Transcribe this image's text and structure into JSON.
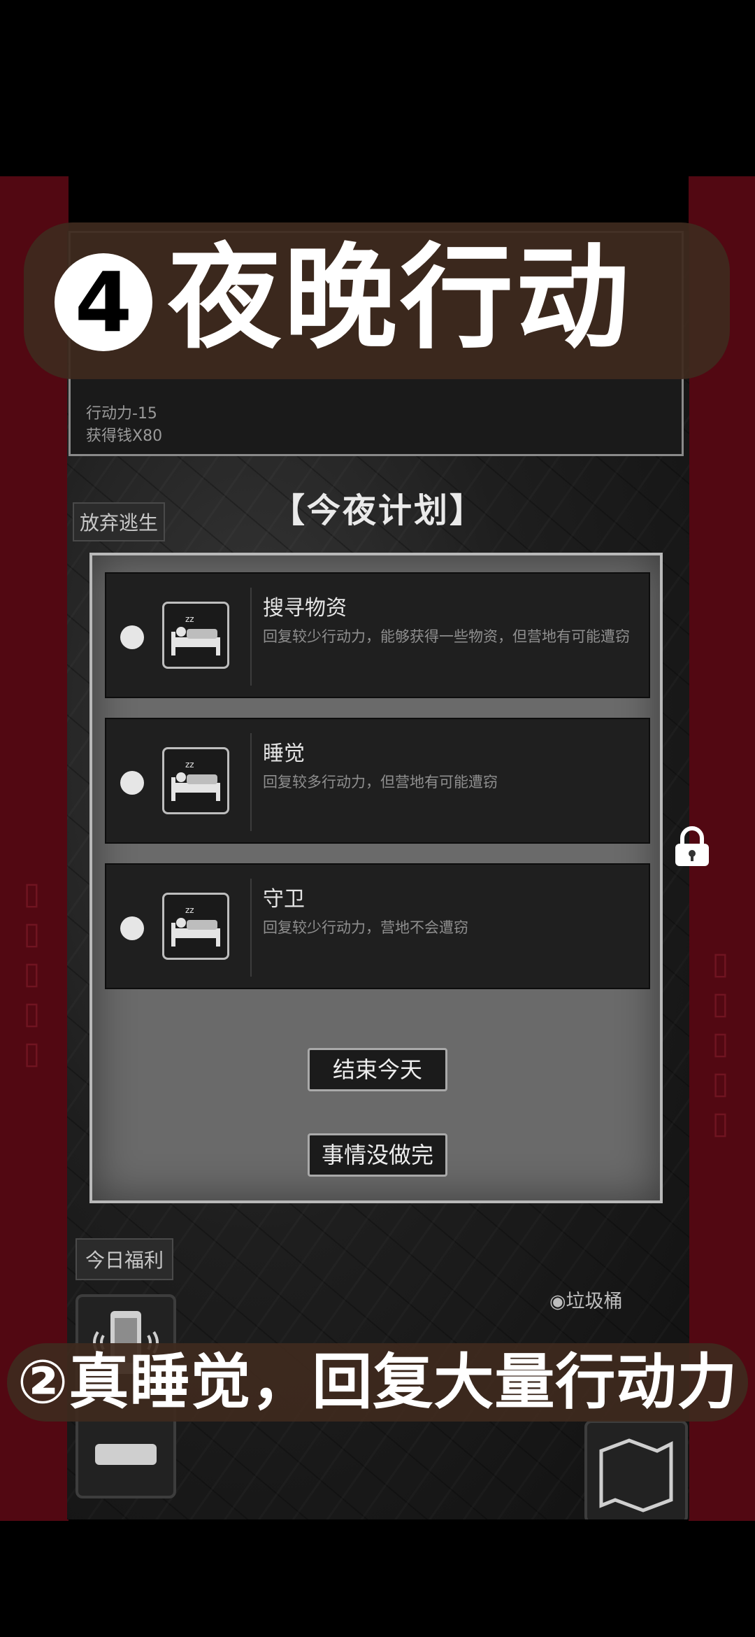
{
  "overlay": {
    "top_number": "4",
    "top_text": "夜晚行动",
    "bottom_text": "②真睡觉，回复大量行动力"
  },
  "log": {
    "line1": "行动力-15",
    "line2": "获得钱X80"
  },
  "buttons": {
    "abandon": "放弃逃生",
    "end_day": "结束今天",
    "not_done": "事情没做完",
    "daily_welfare": "今日福利"
  },
  "plan": {
    "title": "【今夜计划】",
    "options": [
      {
        "title": "搜寻物资",
        "desc": "回复较少行动力，能够获得一些物资，但营地有可能遭窃"
      },
      {
        "title": "睡觉",
        "desc": "回复较多行动力，但营地有可能遭窃"
      },
      {
        "title": "守卫",
        "desc": "回复较少行动力，营地不会遭窃"
      }
    ]
  },
  "map": {
    "trash_label": "◉垃圾桶"
  },
  "icons": {
    "sleep": "sleep-bed-icon",
    "lock": "lock-icon",
    "phone": "phone-icon",
    "key": "key-icon"
  }
}
